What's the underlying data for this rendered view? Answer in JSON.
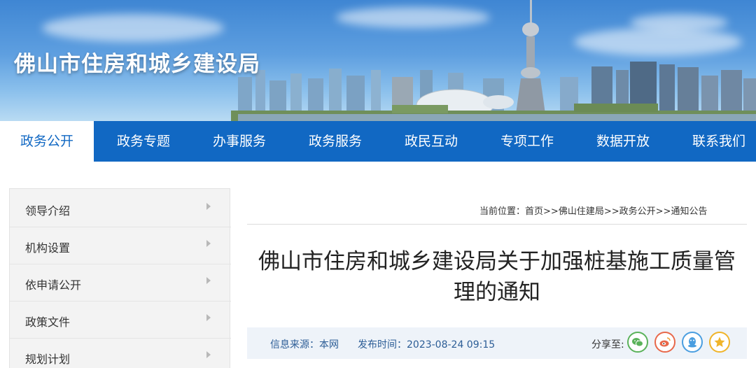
{
  "site": {
    "title": "佛山市住房和城乡建设局"
  },
  "nav": {
    "items": [
      {
        "label": "政务公开",
        "active": true
      },
      {
        "label": "政务专题",
        "active": false
      },
      {
        "label": "办事服务",
        "active": false
      },
      {
        "label": "政务服务",
        "active": false
      },
      {
        "label": "政民互动",
        "active": false
      },
      {
        "label": "专项工作",
        "active": false
      },
      {
        "label": "数据开放",
        "active": false
      },
      {
        "label": "联系我们",
        "active": false
      }
    ]
  },
  "sidebar": {
    "items": [
      {
        "label": "领导介绍"
      },
      {
        "label": "机构设置"
      },
      {
        "label": "依申请公开"
      },
      {
        "label": "政策文件"
      },
      {
        "label": "规划计划"
      }
    ]
  },
  "breadcrumb": {
    "prefix": "当前位置：",
    "items": [
      "首页",
      "佛山住建局",
      "政务公开",
      "通知公告"
    ],
    "separator": ">>"
  },
  "article": {
    "title_line1": "佛山市住房和城乡建设局关于加强桩基施工质量管",
    "title_line2": "理的通知",
    "source": "信息来源：本网",
    "published": "发布时间：2023-08-24 09:15"
  },
  "share": {
    "label": "分享至:",
    "buttons": [
      {
        "icon": "wechat-icon",
        "color": "#5ab25a"
      },
      {
        "icon": "weibo-icon",
        "color": "#e8684a"
      },
      {
        "icon": "qq-icon",
        "color": "#4a9ee0"
      },
      {
        "icon": "qzone-icon",
        "color": "#f0b429"
      }
    ]
  },
  "colors": {
    "nav_bg": "#1168c3",
    "info_text": "#2c5d96"
  }
}
